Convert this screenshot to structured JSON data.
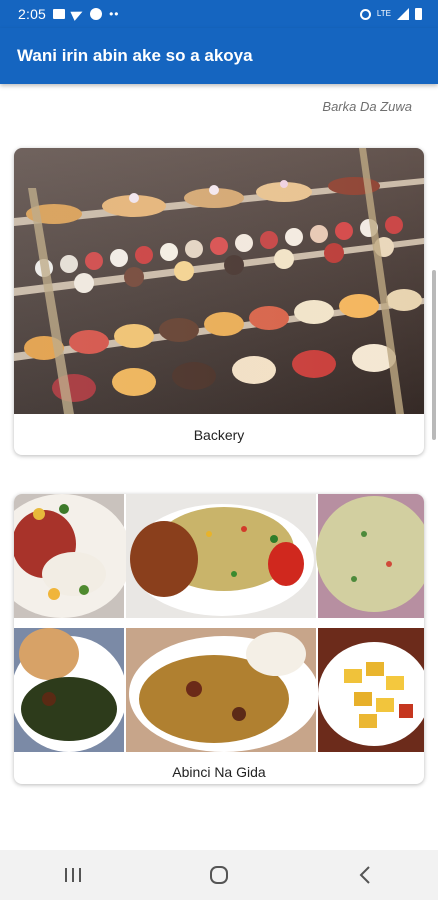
{
  "status_bar": {
    "time": "2:05",
    "network": "LTE",
    "left_icons": [
      "image-icon",
      "telegram-icon",
      "facebook-icon",
      "more-dots-icon"
    ],
    "right_icons": [
      "alarm-icon",
      "lte-icon",
      "signal-icon",
      "battery-icon"
    ]
  },
  "app_bar": {
    "title": "Wani irin abin ake so a akoya"
  },
  "greeting": "Barka Da Zuwa",
  "categories": [
    {
      "label": "Backery",
      "image": "bakery-display-photo"
    },
    {
      "label": "Abinci Na Gida",
      "image": "local-food-collage"
    }
  ],
  "nav_bar": {
    "buttons": [
      "recent-apps-icon",
      "home-icon",
      "back-icon"
    ]
  },
  "colors": {
    "primary": "#1565c0",
    "background": "#ffffff",
    "nav_background": "#f2f2f2"
  }
}
